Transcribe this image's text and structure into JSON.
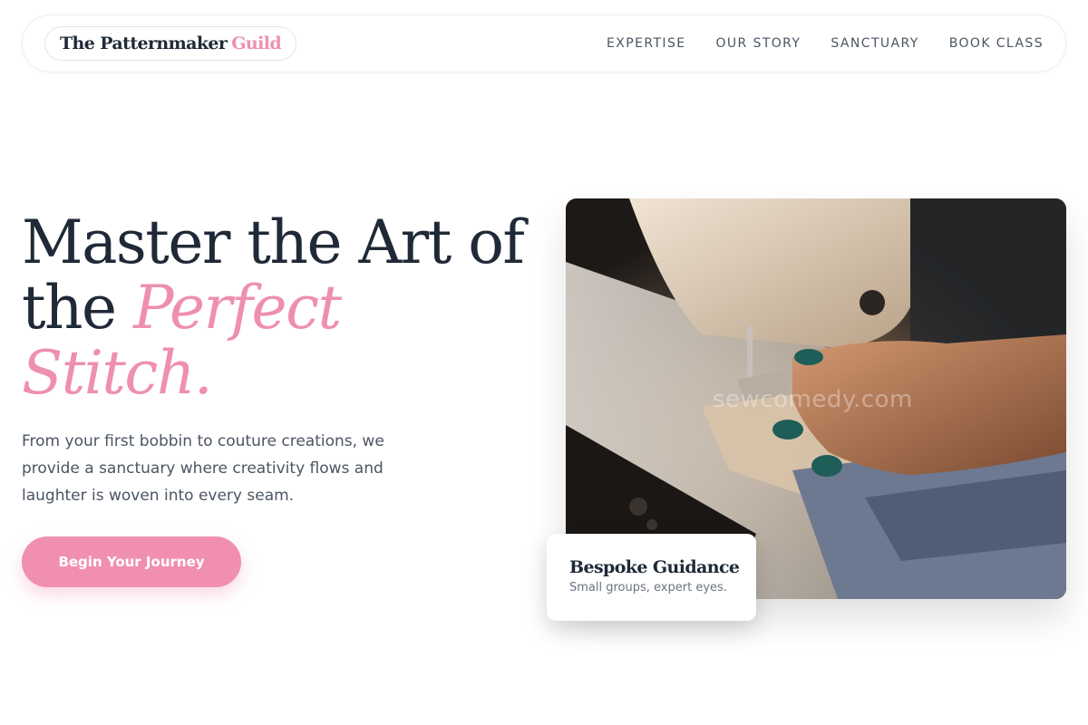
{
  "nav": {
    "logo_main": "The Patternmaker",
    "logo_accent": "Guild",
    "links": [
      "EXPERTISE",
      "OUR STORY",
      "SANCTUARY",
      "BOOK CLASS"
    ]
  },
  "hero": {
    "title_line1": "Master the Art of",
    "title_line2_plain": "the",
    "title_line2_accent": "Perfect",
    "title_line3_accent": "Stitch.",
    "subtitle": "From your first bobbin to couture creations, we provide a sanctuary where creativity flows and laughter is woven into every seam.",
    "cta_label": "Begin Your Journey"
  },
  "image": {
    "watermark": "sewcomedy.com",
    "alt": "Hands guiding fabric under a sewing machine needle"
  },
  "card": {
    "title": "Bespoke Guidance",
    "subtitle": "Small groups, expert eyes."
  },
  "colors": {
    "accent": "#ee8fb2",
    "text_dark": "#1f2937",
    "text_muted": "#4b5563"
  }
}
